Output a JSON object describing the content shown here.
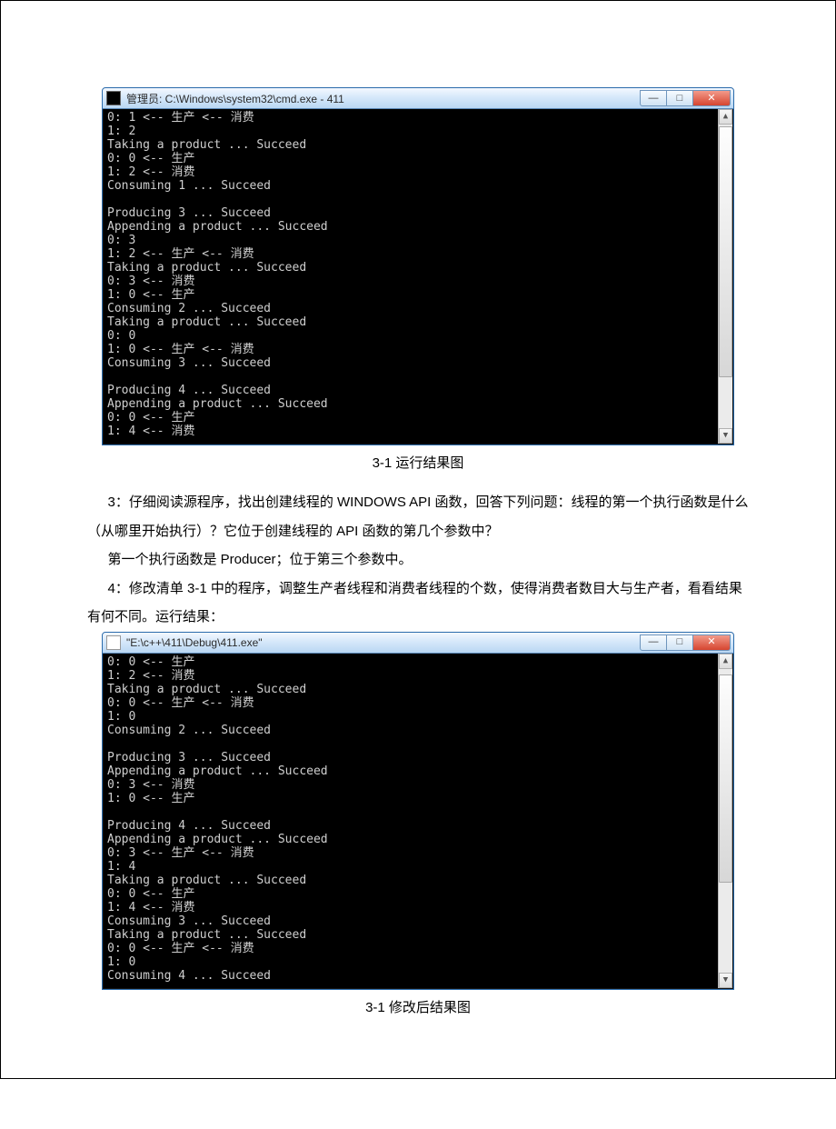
{
  "window1": {
    "title": "管理员: C:\\Windows\\system32\\cmd.exe - 411",
    "output": "0: 1 <-- 生产 <-- 消费\n1: 2\nTaking a product ... Succeed\n0: 0 <-- 生产\n1: 2 <-- 消费\nConsuming 1 ... Succeed\n\nProducing 3 ... Succeed\nAppending a product ... Succeed\n0: 3\n1: 2 <-- 生产 <-- 消费\nTaking a product ... Succeed\n0: 3 <-- 消费\n1: 0 <-- 生产\nConsuming 2 ... Succeed\nTaking a product ... Succeed\n0: 0\n1: 0 <-- 生产 <-- 消费\nConsuming 3 ... Succeed\n\nProducing 4 ... Succeed\nAppending a product ... Succeed\n0: 0 <-- 生产\n1: 4 <-- 消费"
  },
  "caption1": "3-1 运行结果图",
  "para3": "3：仔细阅读源程序，找出创建线程的 WINDOWS API 函数，回答下列问题：线程的第一个执行函数是什么（从哪里开始执行）？它位于创建线程的 API 函数的第几个参数中？",
  "para3ans": "第一个执行函数是 Producer；位于第三个参数中。",
  "para4": "4：修改清单 3-1 中的程序，调整生产者线程和消费者线程的个数，使得消费者数目大与生产者，看看结果有何不同。运行结果：",
  "window2": {
    "title": "\"E:\\c++\\411\\Debug\\411.exe\"",
    "output": "0: 0 <-- 生产\n1: 2 <-- 消费\nTaking a product ... Succeed\n0: 0 <-- 生产 <-- 消费\n1: 0\nConsuming 2 ... Succeed\n\nProducing 3 ... Succeed\nAppending a product ... Succeed\n0: 3 <-- 消费\n1: 0 <-- 生产\n\nProducing 4 ... Succeed\nAppending a product ... Succeed\n0: 3 <-- 生产 <-- 消费\n1: 4\nTaking a product ... Succeed\n0: 0 <-- 生产\n1: 4 <-- 消费\nConsuming 3 ... Succeed\nTaking a product ... Succeed\n0: 0 <-- 生产 <-- 消费\n1: 0\nConsuming 4 ... Succeed"
  },
  "caption2": "3-1 修改后结果图",
  "buttons": {
    "min": "—",
    "max": "□",
    "close": "✕",
    "up": "▲",
    "down": "▼"
  }
}
